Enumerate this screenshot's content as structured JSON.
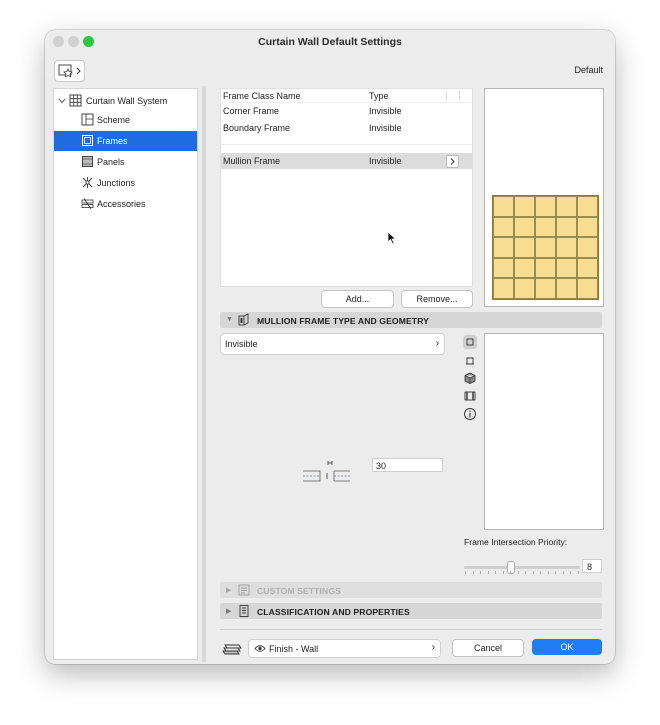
{
  "window": {
    "title": "Curtain Wall Default Settings"
  },
  "toolbar": {
    "favorites_icon": "favorites-star-icon",
    "default_label": "Default"
  },
  "sidebar": {
    "root": {
      "label": "Curtain Wall System",
      "icon": "curtain-wall-icon"
    },
    "items": [
      {
        "label": "Scheme",
        "icon": "scheme-icon"
      },
      {
        "label": "Frames",
        "icon": "frames-icon",
        "selected": true
      },
      {
        "label": "Panels",
        "icon": "panels-icon"
      },
      {
        "label": "Junctions",
        "icon": "junctions-icon"
      },
      {
        "label": "Accessories",
        "icon": "accessories-icon"
      }
    ]
  },
  "frames_table": {
    "columns": [
      "Frame Class Name",
      "Type"
    ],
    "rows": [
      {
        "name": "Corner Frame",
        "type": "Invisible"
      },
      {
        "name": "Boundary Frame",
        "type": "Invisible"
      },
      {
        "name": "Mullion Frame",
        "type": "Invisible",
        "selected": true
      }
    ],
    "add_label": "Add...",
    "remove_label": "Remove..."
  },
  "mullion_section": {
    "title": "MULLION FRAME TYPE AND GEOMETRY",
    "type_value": "Invisible",
    "width_value": "30",
    "priority_label": "Frame Intersection Priority:",
    "priority_value": "8",
    "priority_fraction": 0.4
  },
  "custom_section": {
    "title": "CUSTOM SETTINGS"
  },
  "classification_section": {
    "title": "CLASSIFICATION AND PROPERTIES"
  },
  "footer": {
    "layer_value": "Finish - Wall",
    "cancel_label": "Cancel",
    "ok_label": "OK"
  },
  "colors": {
    "accent": "#1f7cf5",
    "selection": "#1d6ce0",
    "panel_fill": "#f6dd93"
  }
}
